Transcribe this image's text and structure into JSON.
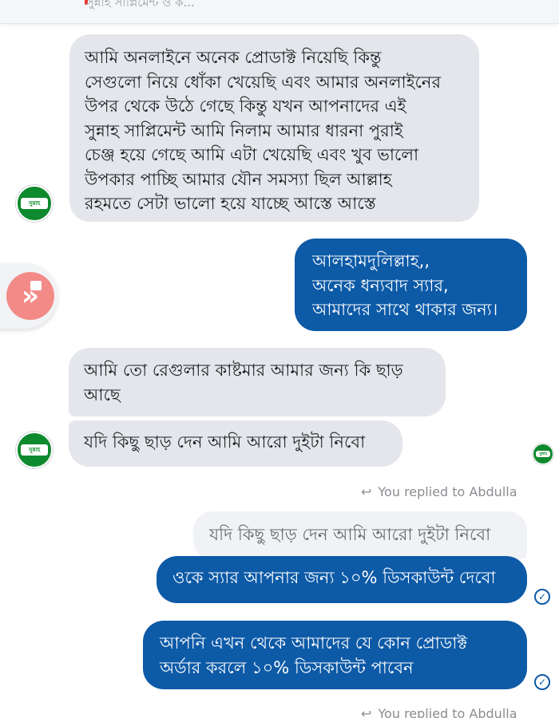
{
  "header": {
    "preview_text": "সুন্নাহ সাপ্লিমেন্ট ও ক..."
  },
  "messages": [
    {
      "lines": [
        "আমি অনলাইনে অনেক প্রোডাক্ট নিয়েছি কিন্তু",
        "সেগুলো নিয়ে ধোঁকা খেয়েছি এবং আমার অনলাইনের",
        "উপর থেকে উঠে গেছে কিন্তু যখন আপনাদের এই",
        "সুন্নাহ সাপ্লিমেন্ট আমি নিলাম আমার ধারনা পুরাই",
        "চেঞ্জ হয়ে গেছে আমি এটা খেয়েছি এবং খুব ভালো",
        "উপকার পাচ্ছি আমার যৌন সমস্যা ছিল আল্লাহ",
        "রহমতে সেটা ভালো হয়ে যাচ্ছে আস্তে আস্তে"
      ]
    },
    {
      "lines": [
        "আলহামদুলিল্লাহ,,",
        "অনেক ধন্যবাদ স্যার,",
        "আমাদের সাথে থাকার জন্য।"
      ]
    },
    {
      "lines": [
        "আমি তো রেগুলার কাষ্টমার আমার জন্য  কি ছাড়",
        "আছে"
      ]
    },
    {
      "lines": [
        "যদি কিছু ছাড় দেন আমি আরো দুইটা নিবো"
      ]
    },
    {
      "lines": [
        "ওকে স্যার আপনার জন্য ১০% ডিসকাউন্ট দেবো"
      ]
    },
    {
      "lines": [
        "আপনি এখন থেকে আমাদের যে কোন প্রোডাক্ট",
        "অর্ডার করলে ১০% ডিসকাউন্ট পাবেন"
      ]
    }
  ],
  "reply": {
    "label": "You replied to Abdulla",
    "quoted_text": "যদি কিছু ছাড় দেন আমি আরো দুইটা নিবো"
  },
  "avatar": {
    "text": "সুন্নাহ"
  },
  "icons": {
    "reply": "reply-arrow-icon",
    "seen": "checkmark-circle-icon",
    "floating": "chat-head-icon"
  },
  "colors": {
    "outgoing_bubble": "#0d5aa7",
    "incoming_bubble": "#e4e6eb",
    "avatar_bg": "#0e8a2e",
    "floating_circle": "#f28b87"
  }
}
